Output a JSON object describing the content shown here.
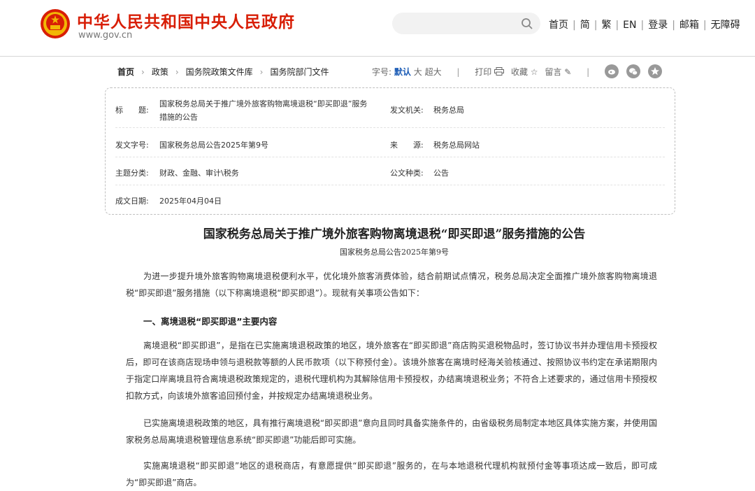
{
  "header": {
    "site_title": "中华人民共和国中央人民政府",
    "site_url": "www.gov.cn",
    "nav": [
      "首页",
      "简",
      "繁",
      "EN",
      "登录",
      "邮箱",
      "无障碍"
    ],
    "nav_sep": "|"
  },
  "breadcrumb": {
    "items": [
      "首页",
      "政策",
      "国务院政策文件库",
      "国务院部门文件"
    ],
    "arrow": "›"
  },
  "tools": {
    "font_label": "字号:",
    "font_default": "默认",
    "font_large": "大",
    "font_xlarge": "超大",
    "print": "打印",
    "favorite": "收藏",
    "comment": "留言",
    "sep": "|"
  },
  "info": {
    "title_label": "标　　题:",
    "title_line1": "国家税务总局关于推广境外旅客购物离境退税“即买即退”服务",
    "title_line2": "措施的公告",
    "issuer_label": "发文机关:",
    "issuer": "税务总局",
    "doc_no_label": "发文字号:",
    "doc_no": "国家税务总局公告2025年第9号",
    "source_label": "来　　源:",
    "source": "税务总局网站",
    "topic_label": "主题分类:",
    "topic": "财政、金融、审计\\税务",
    "type_label": "公文种类:",
    "type": "公告",
    "date_label": "成文日期:",
    "date": "2025年04月04日"
  },
  "article": {
    "title": "国家税务总局关于推广境外旅客购物离境退税“即买即退”服务措施的公告",
    "subtitle": "国家税务总局公告2025年第9号",
    "p1": "为进一步提升境外旅客购物离境退税便利水平，优化境外旅客消费体验，结合前期试点情况，税务总局决定全面推广境外旅客购物离境退税“即买即退”服务措施（以下称离境退税“即买即退”）。现就有关事项公告如下：",
    "h1": "一、离境退税“即买即退”主要内容",
    "p2": "离境退税“即买即退”，是指在已实施离境退税政策的地区，境外旅客在“即买即退”商店购买退税物品时，签订协议书并办理信用卡预授权后，即可在该商店现场申领与退税款等额的人民币款项（以下称预付金）。该境外旅客在离境时经海关验核通过、按照协议书约定在承诺期限内于指定口岸离境且符合离境退税政策规定的，退税代理机构为其解除信用卡预授权，办结离境退税业务；不符合上述要求的，通过信用卡预授权扣款方式，向该境外旅客追回预付金，并按规定办结离境退税业务。",
    "p3": "已实施离境退税政策的地区，具有推行离境退税“即买即退”意向且同时具备实施条件的，由省级税务局制定本地区具体实施方案，并使用国家税务总局离境退税管理信息系统“即买即退”功能后即可实施。",
    "p4": "实施离境退税“即买即退”地区的退税商店，有意愿提供“即买即退”服务的，在与本地退税代理机构就预付金等事项达成一致后，即可成为“即买即退”商店。"
  },
  "colors": {
    "brand_red": "#d81e06",
    "link_blue": "#1a5bb5",
    "share_grey": "#999999"
  },
  "icons": [
    "national-emblem-icon",
    "search-icon",
    "print-icon",
    "star-icon",
    "pencil-icon",
    "weibo-icon",
    "wechat-icon",
    "favorite-star-icon"
  ]
}
